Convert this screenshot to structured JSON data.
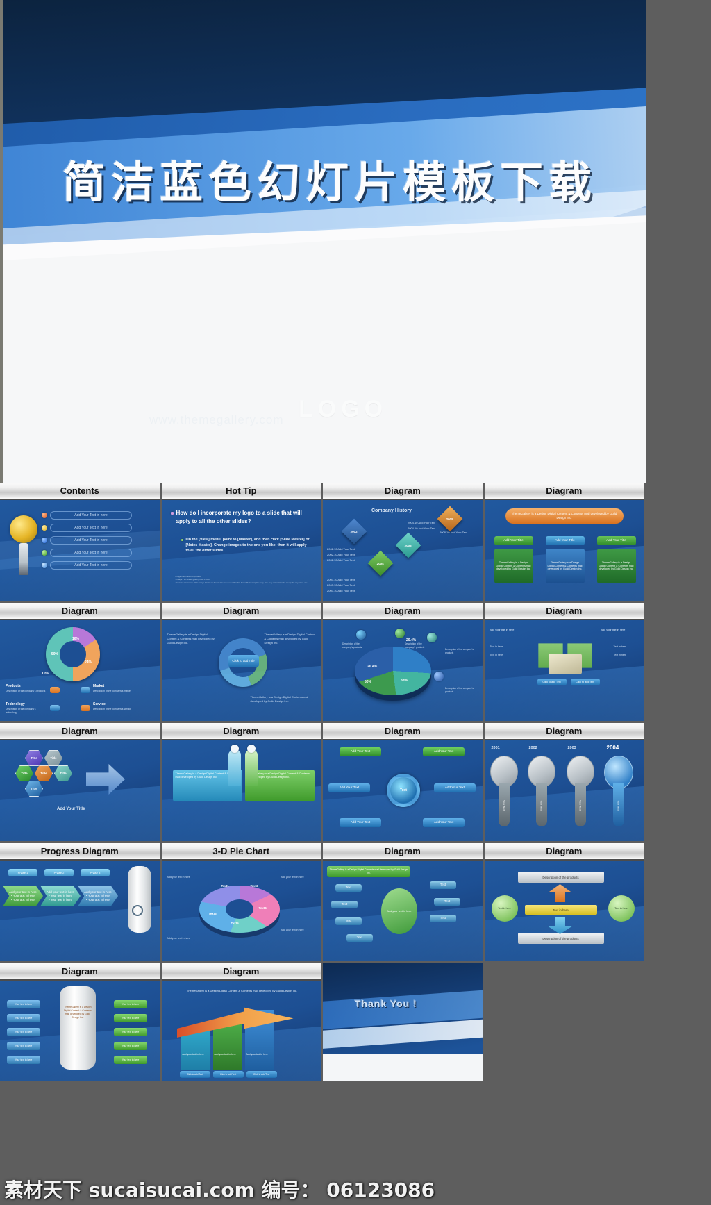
{
  "hero": {
    "title": "简洁蓝色幻灯片模板下载",
    "logo": "LOGO",
    "ghost_text": "www.themegallery.com"
  },
  "watermark": {
    "site_cn": "素材天下",
    "site_url": "sucaisucai.com",
    "id_label": "编号：",
    "id_value": "06123086",
    "full": "素材天下 sucaisucai.com  编号： 06123086"
  },
  "colors": {
    "hero_dark_blue": "#0c233f",
    "hero_mid_blue": "#1d5399",
    "slide_blue": "#1d4f93",
    "caption_silver": "#c9c9c9",
    "frame_gray": "#5e5e5e",
    "accent_green": "#43a047",
    "accent_orange": "#e8883a",
    "accent_teal": "#4bbfb4",
    "accent_purple": "#b濃"
  },
  "grid": {
    "rows": [
      {
        "cells": [
          {
            "caption": "Contents",
            "kind": "contents",
            "items": [
              "Add Your Text in here",
              "Add Your Text in here",
              "Add Your Text in here",
              "Add Your Text in here",
              "Add Your Text in here"
            ]
          },
          {
            "caption": "Hot Tip",
            "kind": "hottip",
            "heading": "How do I incorporate my logo to a slide that will apply to all the other slides?",
            "body": "On the [View] menu, point to [Master], and then click [Slide Master] or [Notes Master]. Change images to the one you like, then it will apply to all the other slides.",
            "footnote": "Image Information in product\n▪ Image : 3D Radio globe phase Photo\n▪ Note to customers : This image has been licensed to be used within this PowerPoint template only. You may not extract the image for any other use."
          },
          {
            "caption": "Diagram",
            "kind": "history",
            "title": "Company History",
            "years": [
              "2002",
              "2003",
              "2004",
              "2008"
            ],
            "notes": [
              "2002.10  Add Your Text",
              "2002.10  Add Your Text",
              "2002.10  Add Your Text",
              "2003.10  Add Your Text",
              "2003.10  Add Your Text",
              "2003.10  Add Your Text",
              "2004.10  Add Your Text",
              "2004.10  Add Your Text",
              "2004.10  Add Your Text",
              "2008.10  Add Your Text",
              "2008.10  Add Your Text"
            ]
          },
          {
            "caption": "Diagram",
            "kind": "orgchart",
            "top": "ThemeGallery is a Design Digital Content & Contents mall developed by Guild Design Inc.",
            "titles": [
              "Add Your Title",
              "Add Your Title",
              "Add Your Title"
            ],
            "bodies": [
              "ThemeGallery is a Design Digital Content & Contents mall developed by Guild Design Inc.",
              "ThemeGallery is a Design Digital Content & Contents mall developed by Guild Design Inc.",
              "ThemeGallery is a Design Digital Content & Contents mall developed by Guild Design Inc."
            ]
          }
        ]
      },
      {
        "cells": [
          {
            "caption": "Diagram",
            "kind": "donut",
            "slices": [
              {
                "label": "50%",
                "value": 50,
                "color": "#5fc4b8"
              },
              {
                "label": "24%",
                "value": 24,
                "color": "#f0a45c"
              },
              {
                "label": "16%",
                "value": 16,
                "color": "#b878d8"
              },
              {
                "label": "10%",
                "value": 10,
                "color": "#f0a45c"
              }
            ],
            "legend": [
              {
                "title": "Products",
                "desc": "Description of the company's products"
              },
              {
                "title": "Market",
                "desc": "Description of the company's market"
              },
              {
                "title": "Technology",
                "desc": "Description of the company's technology"
              },
              {
                "title": "Service",
                "desc": "Description of the company's service"
              }
            ]
          },
          {
            "caption": "Diagram",
            "kind": "cycle",
            "center": "Click to add Title",
            "left": "ThemeGallery is a Design Digital Content & Contents mall developed by Guild Design Inc.",
            "right": "ThemeGallery is a Design Digital Content & Contents mall developed by Guild Design Inc.",
            "bottom": "ThemeGallery is a Design Digital Contents mall developed by Guild Design Inc."
          },
          {
            "caption": "Diagram",
            "kind": "pie3d",
            "slices": [
              {
                "label": "50%",
                "value": 50,
                "color": "#2f7fc7"
              },
              {
                "label": "20.4%",
                "value": 20.4,
                "color": "#3d9a4e"
              },
              {
                "label": "20.4%",
                "value": 20.4,
                "color": "#43b5a0"
              },
              {
                "label": "38%",
                "value": 38,
                "color": "#2b5fa8"
              }
            ],
            "callouts": [
              "Description of the company's products",
              "Description of the company's products",
              "Description of the company's products",
              "Description of the company's products"
            ]
          },
          {
            "caption": "Diagram",
            "kind": "arrows4",
            "texts": [
              "Add your title in here",
              "Add your title in here",
              "Click to add Text",
              "Click to add Text",
              "Text in here",
              "Text in here",
              "Text in here",
              "Text in here"
            ]
          }
        ]
      },
      {
        "cells": [
          {
            "caption": "Diagram",
            "kind": "hex",
            "hex_labels": [
              "Title",
              "Title",
              "Title",
              "Title",
              "Title",
              "Title"
            ],
            "footer": "Add Your Title"
          },
          {
            "caption": "Diagram",
            "kind": "twopanel",
            "panels": [
              "ThemeGallery is a Design Digital Content & Contents mall developed by Guild Design Inc.",
              "ThemeGallery is a Design Digital Content & Contents mall developed by Guild Design Inc."
            ]
          },
          {
            "caption": "Diagram",
            "kind": "hub",
            "center": "Text",
            "boxes": [
              "Add Your Text",
              "Add Your Text",
              "Add Your Text",
              "Add Your Text",
              "Add Your Text",
              "Add Your Text"
            ]
          },
          {
            "caption": "Diagram",
            "kind": "timeline",
            "years": [
              "2001",
              "2002",
              "2003",
              "2004"
            ],
            "labels": [
              "Your Text",
              "Your Text",
              "Your Text",
              "Your Text"
            ]
          }
        ]
      },
      {
        "cells": [
          {
            "caption": "Progress Diagram",
            "kind": "progress",
            "phases": [
              "Phase 1",
              "Phase 2",
              "Phase 3"
            ],
            "bodies": [
              "Add your text in here\n• Your text in here\n• Your text in here",
              "Add your text in here\n• Your text in here\n• Your text in here",
              "Add your text in here\n• Your text in here\n• Your text in here"
            ]
          },
          {
            "caption": "3-D Pie Chart",
            "kind": "pie3d2",
            "labels": [
              "Text1",
              "Text2",
              "Text3",
              "Text4",
              "Text5"
            ],
            "notes": [
              "Add your text in here",
              "Add your text in here",
              "Add your text in here",
              "Add your text in here"
            ]
          },
          {
            "caption": "Diagram",
            "kind": "tree",
            "top": "ThemeGallery is a Design Digital Contents mall developed by Guild Design Inc.",
            "center": "Add your text in here",
            "leaves": [
              "Text",
              "Text",
              "Text",
              "Text",
              "Text",
              "Text",
              "Text"
            ]
          },
          {
            "caption": "Diagram",
            "kind": "opposing",
            "bars": [
              "Description of the products",
              "Description of the products"
            ],
            "circles": [
              "Text in here",
              "Text in here"
            ],
            "mid": [
              "Text in here",
              "Text in here"
            ]
          }
        ]
      },
      {
        "cells": [
          {
            "caption": "Diagram",
            "kind": "pillar",
            "center": "ThemeGallery is a Design Digital Content & Contents mall developed by Guild Design Inc.",
            "left": [
              "Your text  in here",
              "Your text  in here",
              "Your text  in here",
              "Your text  in here",
              "Your text  in here"
            ],
            "right": [
              "Your text  in here",
              "Your text  in here",
              "Your text  in here",
              "Your text  in here",
              "Your text  in here"
            ]
          },
          {
            "caption": "Diagram",
            "kind": "growth",
            "top": "ThemeGallery is a Design Digital Content & Contents mall developed by Guild Design Inc.",
            "steps": [
              "Add your text in here",
              "Add your text in here",
              "Add your text in here"
            ],
            "buttons": [
              "Click to add Text",
              "Click to add Text",
              "Click to add Text"
            ]
          },
          {
            "caption": "",
            "kind": "thankyou",
            "text": "Thank You !"
          },
          {
            "caption": "",
            "kind": "empty"
          }
        ]
      }
    ]
  }
}
